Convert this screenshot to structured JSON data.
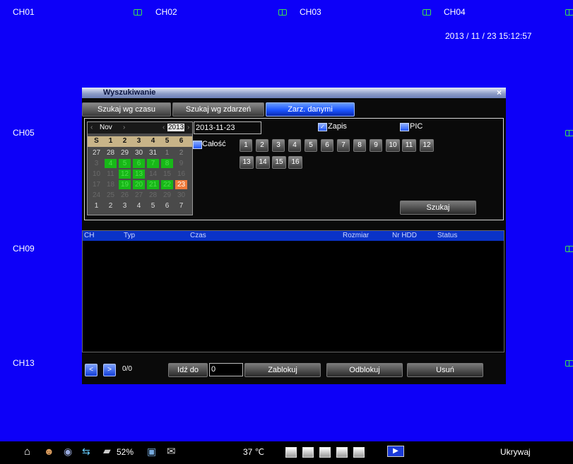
{
  "channels": [
    "CH01",
    "CH02",
    "CH03",
    "CH04",
    "CH05",
    "CH09",
    "CH13"
  ],
  "datetime": "2013 / 11 / 23  15:12:57",
  "dialog": {
    "title": "Wyszukiwanie",
    "close": "×",
    "tabs": [
      "Szukaj wg czasu",
      "Szukaj wg zdarzeń",
      "Zarz. danymi"
    ],
    "active_tab": "Zarz. danymi"
  },
  "calendar": {
    "prev": "‹",
    "month": "Nov",
    "next_month": "›",
    "year_prev": "‹",
    "year": "2013",
    "year_next": "›",
    "dow": [
      "S",
      "1",
      "2",
      "3",
      "4",
      "5",
      "6"
    ],
    "rows": [
      [
        "27",
        "28",
        "29",
        "30",
        "31",
        "1",
        "2"
      ],
      [
        "3",
        "4",
        "5",
        "6",
        "7",
        "8",
        "9"
      ],
      [
        "10",
        "11",
        "12",
        "13",
        "14",
        "15",
        "16"
      ],
      [
        "17",
        "18",
        "19",
        "20",
        "21",
        "22",
        "23"
      ],
      [
        "24",
        "25",
        "26",
        "27",
        "28",
        "29",
        "30"
      ],
      [
        "1",
        "2",
        "3",
        "4",
        "5",
        "6",
        "7"
      ]
    ],
    "record_days": [
      "4",
      "5",
      "6",
      "7",
      "8",
      "12",
      "13",
      "19",
      "20",
      "21",
      "22"
    ],
    "today": "23"
  },
  "search": {
    "date": "2013-11-23",
    "zapis_label": "Zapis",
    "pic_label": "PIC",
    "all_label": "Całość",
    "channels": [
      "1",
      "2",
      "3",
      "4",
      "5",
      "6",
      "7",
      "8",
      "9",
      "10",
      "11",
      "12",
      "13",
      "14",
      "15",
      "16"
    ],
    "search_button": "Szukaj"
  },
  "results": {
    "columns": [
      "CH",
      "Typ",
      "Czas",
      "Rozmiar",
      "Nr HDD",
      "Status"
    ]
  },
  "pager": {
    "prev": "<",
    "next": ">",
    "page": "0/0",
    "goto_label": "Idź do",
    "goto_value": "0",
    "lock": "Zablokuj",
    "unlock": "Odblokuj",
    "delete": "Usuń"
  },
  "taskbar": {
    "battery": "52%",
    "temperature": "37 ℃",
    "hide": "Ukrywaj"
  }
}
